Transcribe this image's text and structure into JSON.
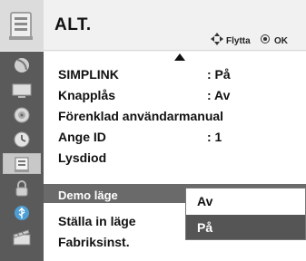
{
  "header": {
    "title": "ALT.",
    "icon": "tv-options-icon",
    "hints": [
      {
        "icon": "move-arrows-icon",
        "label": "Flytta"
      },
      {
        "icon": "ok-button-icon",
        "label": "OK"
      }
    ]
  },
  "sidebar": {
    "items": [
      {
        "icon": "satellite-dish-icon",
        "active": false
      },
      {
        "icon": "picture-monitor-icon",
        "active": false
      },
      {
        "icon": "speaker-audio-icon",
        "active": false
      },
      {
        "icon": "clock-time-icon",
        "active": false
      },
      {
        "icon": "options-icon",
        "active": true
      },
      {
        "icon": "lock-icon",
        "active": false
      },
      {
        "icon": "usb-icon",
        "active": false
      },
      {
        "icon": "media-film-icon",
        "active": false
      }
    ]
  },
  "menu": {
    "scroll_up_indicator": true,
    "rows": [
      {
        "label": "SIMPLINK",
        "value": ": På"
      },
      {
        "label": "Knapplås",
        "value": ": Av"
      },
      {
        "label": "Förenklad användarmanual",
        "value": ""
      },
      {
        "label": "Ange ID",
        "value": ": 1"
      },
      {
        "label": "Lysdiod",
        "value": ""
      },
      {
        "label": "Demo läge",
        "value": "",
        "selected": true
      },
      {
        "label": "Ställa in läge",
        "value": ""
      },
      {
        "label": "Fabriksinst.",
        "value": ""
      }
    ]
  },
  "dropdown": {
    "for": "Demo läge",
    "options": [
      {
        "label": "Av",
        "highlighted": false
      },
      {
        "label": "På",
        "highlighted": true
      }
    ]
  },
  "colors": {
    "sidebar_bg": "#5a5a5a",
    "selected_row_bg": "#6a6a6a",
    "dropdown_highlight_bg": "#555555",
    "body_bg": "#ffffff"
  }
}
